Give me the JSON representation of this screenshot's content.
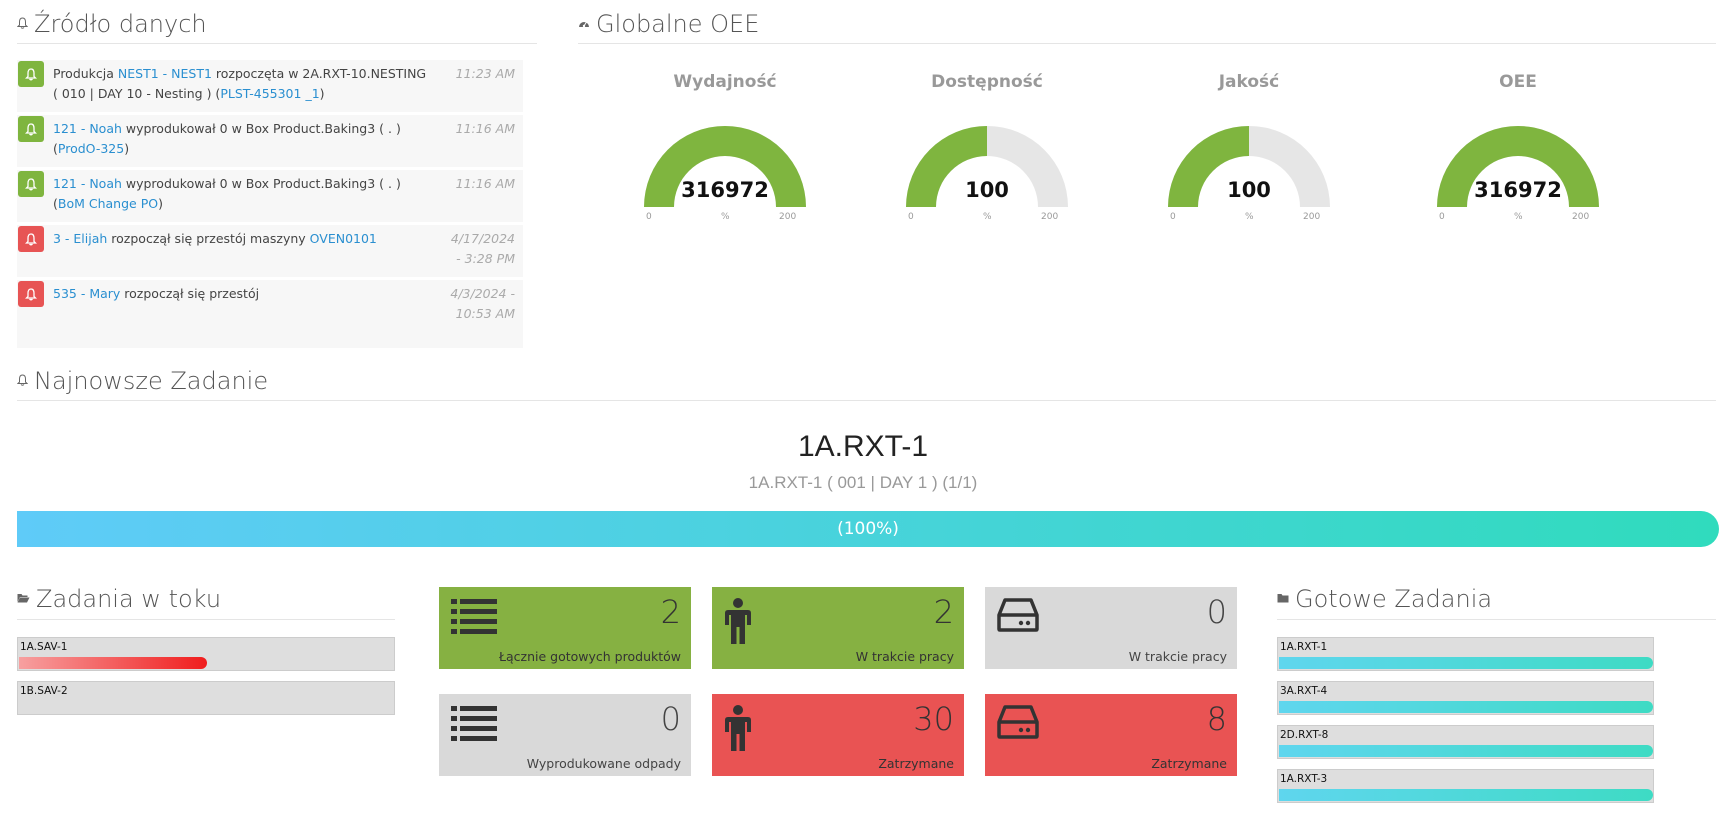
{
  "source": {
    "title": "Źródło danych",
    "items": [
      {
        "type": "green",
        "pre": "Produkcja ",
        "link1": "NEST1 - NEST1",
        "mid": " rozpoczęta w 2A.RXT-10.NESTING ( 010 | DAY 10 - Nesting ) (",
        "link2": "PLST-455301 _1",
        "post": ")",
        "time": "11:23 AM"
      },
      {
        "type": "green",
        "pre": "",
        "link1": "121 - Noah",
        "mid": " wyprodukował 0 w Box Product.Baking3 ( . ) (",
        "link2": "ProdO-325",
        "post": ")",
        "time": "11:16 AM"
      },
      {
        "type": "green",
        "pre": "",
        "link1": "121 - Noah",
        "mid": " wyprodukował 0 w Box Product.Baking3 ( . ) (",
        "link2": "BoM Change PO",
        "post": ")",
        "time": "11:16 AM"
      },
      {
        "type": "red",
        "pre": "",
        "link1": "3 - Elijah",
        "mid": " rozpoczął się przestój maszyny ",
        "link2": "OVEN0101",
        "post": "",
        "time": "4/17/2024 - 3:28 PM"
      },
      {
        "type": "red",
        "pre": "",
        "link1": "535 - Mary",
        "mid": " rozpoczął się przestój",
        "link2": "",
        "post": "",
        "time": "4/3/2024 - 10:53 AM"
      }
    ]
  },
  "oee": {
    "title": "Globalne OEE",
    "gauges": [
      {
        "label": "Wydajność",
        "value": "316972",
        "min": "0",
        "max": "200",
        "unit": "%",
        "fraction": 1.0
      },
      {
        "label": "Dostępność",
        "value": "100",
        "min": "0",
        "max": "200",
        "unit": "%",
        "fraction": 0.5
      },
      {
        "label": "Jakość",
        "value": "100",
        "min": "0",
        "max": "200",
        "unit": "%",
        "fraction": 0.5
      },
      {
        "label": "OEE",
        "value": "316972",
        "min": "0",
        "max": "200",
        "unit": "%",
        "fraction": 1.0
      }
    ]
  },
  "latest": {
    "title": "Najnowsze Zadanie",
    "name": "1A.RXT-1",
    "subtitle": "1A.RXT-1 ( 001 | DAY 1 ) (1/1)",
    "progress_label": "(100%)",
    "progress": 1.0
  },
  "in_progress": {
    "title": "Zadania w toku",
    "items": [
      {
        "label": "1A.SAV-1",
        "progress": 0.5
      },
      {
        "label": "1B.SAV-2",
        "progress": 0
      }
    ]
  },
  "tiles": [
    {
      "value": "2",
      "caption": "Łącznie gotowych produktów",
      "color": "green",
      "icon": "list-icon"
    },
    {
      "value": "2",
      "caption": "W trakcie pracy",
      "color": "green",
      "icon": "person-icon"
    },
    {
      "value": "0",
      "caption": "W trakcie pracy",
      "color": "gray",
      "icon": "drive-icon"
    },
    {
      "value": "0",
      "caption": "Wyprodukowane odpady",
      "color": "gray",
      "icon": "list-icon"
    },
    {
      "value": "30",
      "caption": "Zatrzymane",
      "color": "red",
      "icon": "person-icon"
    },
    {
      "value": "8",
      "caption": "Zatrzymane",
      "color": "red",
      "icon": "drive-icon"
    }
  ],
  "done": {
    "title": "Gotowe Zadania",
    "items": [
      {
        "label": "1A.RXT-1",
        "progress": 1.0
      },
      {
        "label": "3A.RXT-4",
        "progress": 1.0
      },
      {
        "label": "2D.RXT-8",
        "progress": 1.0
      },
      {
        "label": "1A.RXT-3",
        "progress": 1.0
      }
    ]
  },
  "colors": {
    "green": "#86b142",
    "gauge_green": "#7fb53f",
    "red": "#e95353",
    "gray": "#d9d9d9",
    "cyan": "#5fd6ee"
  }
}
